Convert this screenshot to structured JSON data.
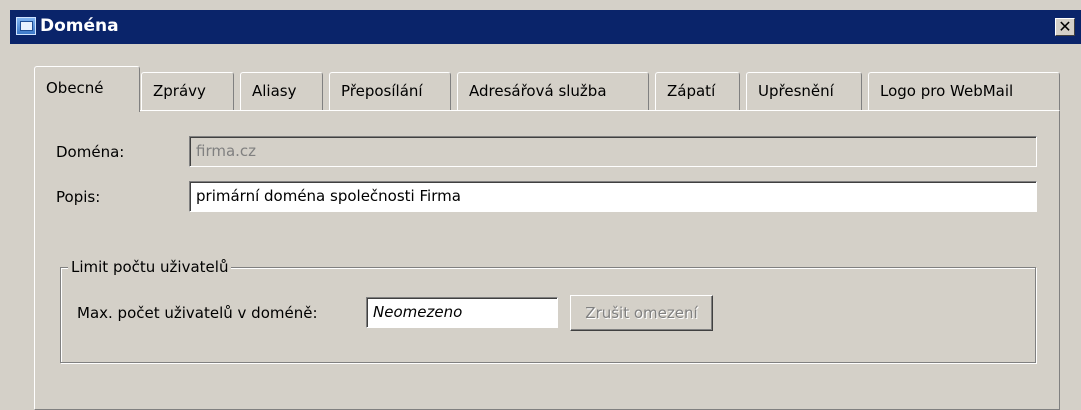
{
  "window": {
    "title": "Doména",
    "close_symbol": "✕"
  },
  "tabs": [
    {
      "label": "Obecné",
      "active": true
    },
    {
      "label": "Zprávy"
    },
    {
      "label": "Aliasy"
    },
    {
      "label": "Přeposílání"
    },
    {
      "label": "Adresářová služba"
    },
    {
      "label": "Zápatí"
    },
    {
      "label": "Upřesnění"
    },
    {
      "label": "Logo pro WebMail"
    }
  ],
  "form": {
    "domain": {
      "label": "Doména:",
      "value": "firma.cz"
    },
    "description": {
      "label": "Popis:",
      "value": "primární doména společnosti Firma"
    }
  },
  "user_limit": {
    "group_title": "Limit počtu uživatelů",
    "max_label": "Max. počet uživatelů v doméně:",
    "max_value": "Neomezeno",
    "remove_button": "Zrušit omezení"
  }
}
